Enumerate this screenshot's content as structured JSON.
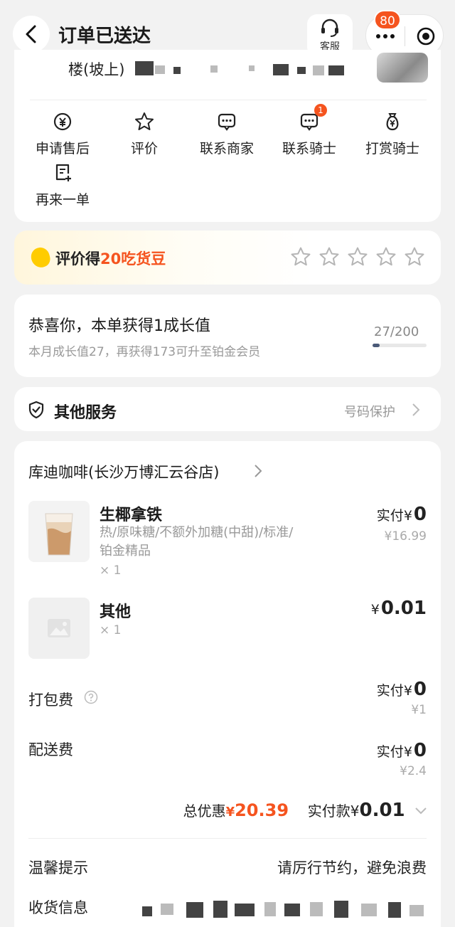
{
  "header": {
    "title": "订单已送达",
    "customer_service": "客服",
    "notification_count": "80"
  },
  "address": {
    "text": "楼(坡上)"
  },
  "actions": [
    {
      "label": "申请售后",
      "icon": "yuan-refund-icon"
    },
    {
      "label": "评价",
      "icon": "star-outline-icon"
    },
    {
      "label": "联系商家",
      "icon": "chat-icon"
    },
    {
      "label": "联系骑士",
      "icon": "chat-icon",
      "badge": "1"
    },
    {
      "label": "打赏骑士",
      "icon": "money-bag-icon"
    },
    {
      "label": "再来一单",
      "icon": "reorder-icon"
    }
  ],
  "rating": {
    "prefix": "评价得",
    "highlight": "20吃货豆",
    "stars": 5
  },
  "growth": {
    "title": "恭喜你，本单获得1成长值",
    "subtitle": "本月成长值27，再获得173可升至铂金会员",
    "progress_text": "27/200",
    "progress_fraction": 0.135
  },
  "services": {
    "title": "其他服务",
    "right": "号码保护"
  },
  "order": {
    "store": "库迪咖啡(长沙万博汇云谷店)",
    "items": [
      {
        "name": "生椰拿铁",
        "desc_line1": "热/原味糖/不额外加糖(中甜)/标准/",
        "desc_line2": "铂金精品",
        "qty": "× 1",
        "paid_label": "实付",
        "currency": "¥",
        "paid": "0",
        "orig": "¥16.99"
      },
      {
        "name": "其他",
        "qty": "× 1",
        "currency": "¥",
        "price": "0.01"
      }
    ],
    "fees": [
      {
        "label": "打包费",
        "paid_label": "实付",
        "currency": "¥",
        "paid": "0",
        "orig": "¥1"
      },
      {
        "label": "配送费",
        "paid_label": "实付",
        "currency": "¥",
        "paid": "0",
        "orig": "¥2.4"
      }
    ],
    "total": {
      "discount_label": "总优惠",
      "currency": "¥",
      "discount": "20.39",
      "paid_label": "实付款",
      "paid": "0.01"
    },
    "tip_label": "温馨提示",
    "tip_value": "请厉行节约，避免浪费",
    "receiver_label": "收货信息"
  },
  "colors": {
    "accent": "#f5541f",
    "star": "#b5b5b5",
    "bean": "#ffcc00"
  }
}
